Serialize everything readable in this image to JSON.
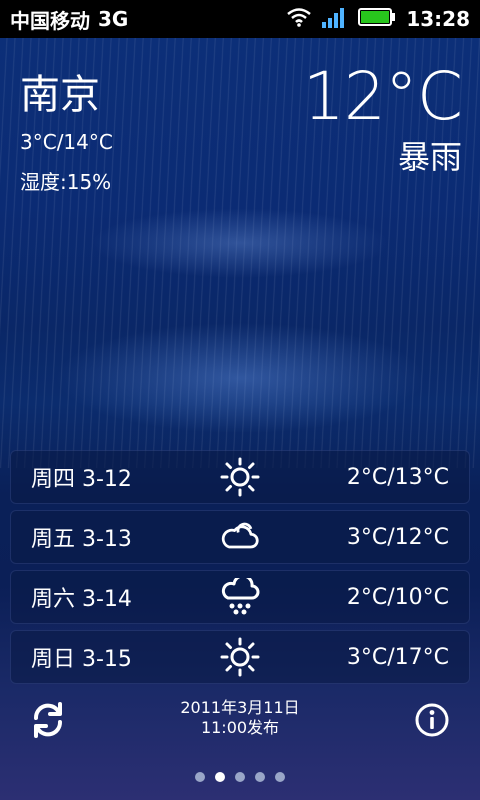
{
  "status": {
    "carrier": "中国移动",
    "network": "3G",
    "time": "13:28"
  },
  "weather": {
    "city": "南京",
    "temp_range": "3°C/14°C",
    "humidity": "湿度:15%",
    "current_temp": "12°C",
    "condition": "暴雨"
  },
  "forecast": [
    {
      "day": "周四 3-12",
      "icon": "sun-icon",
      "range": "2°C/13°C"
    },
    {
      "day": "周五 3-13",
      "icon": "cloud-icon",
      "range": "3°C/12°C"
    },
    {
      "day": "周六 3-14",
      "icon": "snow-icon",
      "range": "2°C/10°C"
    },
    {
      "day": "周日 3-15",
      "icon": "sun-icon",
      "range": "3°C/17°C"
    }
  ],
  "footer": {
    "published_line1": "2011年3月11日",
    "published_line2": "11:00发布"
  },
  "pager": {
    "count": 5,
    "active_index": 1
  }
}
